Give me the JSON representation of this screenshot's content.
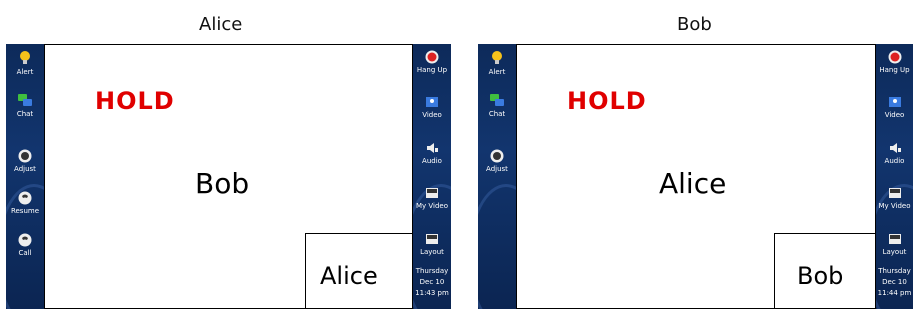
{
  "panels": [
    {
      "title": "Alice",
      "hold_text": "HOLD",
      "remote_name": "Bob",
      "self_view_name": "Alice",
      "left_menu": [
        {
          "label": "Alert",
          "icon": "bulb-icon"
        },
        {
          "label": "Chat",
          "icon": "chat-icon"
        },
        {
          "label": "Adjust",
          "icon": "adjust-icon"
        },
        {
          "label": "Resume",
          "icon": "resume-icon"
        },
        {
          "label": "Call",
          "icon": "call-icon"
        }
      ],
      "right_menu": [
        {
          "label": "Hang Up",
          "icon": "hangup-icon"
        },
        {
          "label": "Video",
          "icon": "video-icon"
        },
        {
          "label": "Audio",
          "icon": "audio-icon"
        },
        {
          "label": "My Video",
          "icon": "my-video-icon"
        },
        {
          "label": "Layout",
          "icon": "layout-icon"
        }
      ],
      "clock": {
        "day": "Thursday",
        "date": "Dec 10",
        "time": "11:43 pm"
      }
    },
    {
      "title": "Bob",
      "hold_text": "HOLD",
      "remote_name": "Alice",
      "self_view_name": "Bob",
      "left_menu": [
        {
          "label": "Alert",
          "icon": "bulb-icon"
        },
        {
          "label": "Chat",
          "icon": "chat-icon"
        },
        {
          "label": "Adjust",
          "icon": "adjust-icon"
        }
      ],
      "right_menu": [
        {
          "label": "Hang Up",
          "icon": "hangup-icon"
        },
        {
          "label": "Video",
          "icon": "video-icon"
        },
        {
          "label": "Audio",
          "icon": "audio-icon"
        },
        {
          "label": "My Video",
          "icon": "my-video-icon"
        },
        {
          "label": "Layout",
          "icon": "layout-icon"
        }
      ],
      "clock": {
        "day": "Thursday",
        "date": "Dec 10",
        "time": "11:44 pm"
      }
    }
  ],
  "colors": {
    "hold": "#e00000",
    "sidebar": "#12356e"
  }
}
